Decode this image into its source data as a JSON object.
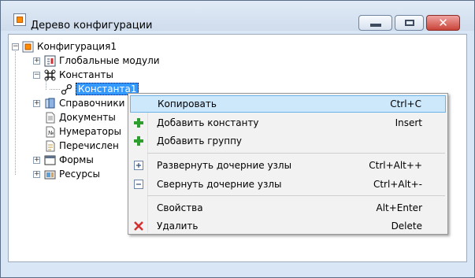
{
  "window": {
    "title": "Дерево конфигурации"
  },
  "tree": {
    "root": "Конфигурация1",
    "items": [
      {
        "label": "Глобальные модули",
        "icon": "module-icon"
      },
      {
        "label": "Константы",
        "icon": "constants-icon"
      },
      {
        "label": "Константа1",
        "icon": "constant-icon",
        "selected": true
      },
      {
        "label": "Справочники",
        "icon": "reference-book-icon"
      },
      {
        "label": "Документы",
        "icon": "document-icon"
      },
      {
        "label": "Нумераторы",
        "icon": "numerator-icon"
      },
      {
        "label": "Перечислен",
        "icon": "enumeration-icon"
      },
      {
        "label": "Формы",
        "icon": "form-icon"
      },
      {
        "label": "Ресурсы",
        "icon": "resources-icon"
      }
    ]
  },
  "context_menu": {
    "items": [
      {
        "label": "Копировать",
        "shortcut": "Ctrl+C",
        "icon": "",
        "highlighted": true
      },
      {
        "label": "Добавить константу",
        "shortcut": "Insert",
        "icon": "plus-icon"
      },
      {
        "label": "Добавить группу",
        "shortcut": "",
        "icon": "plus-icon"
      },
      {
        "label": "Развернуть дочерние узлы",
        "shortcut": "Ctrl+Alt++",
        "icon": "expand-icon"
      },
      {
        "label": "Свернуть дочерние узлы",
        "shortcut": "Ctrl+Alt+-",
        "icon": "collapse-icon"
      },
      {
        "label": "Свойства",
        "shortcut": "Alt+Enter",
        "icon": ""
      },
      {
        "label": "Удалить",
        "shortcut": "Delete",
        "icon": "delete-icon"
      }
    ]
  },
  "colors": {
    "selection": "#3399ff",
    "menu_highlight": "#cde7fb",
    "close_button": "#c9443a",
    "plus_green": "#2e9e2e",
    "delete_red": "#d32f2f"
  }
}
